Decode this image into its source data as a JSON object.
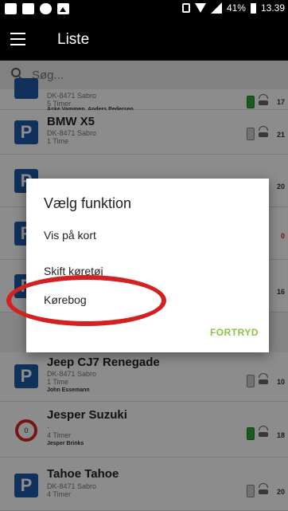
{
  "statusbar": {
    "battery_text": "41%",
    "time": "13.39"
  },
  "appbar": {
    "title": "Liste"
  },
  "search": {
    "placeholder": "Søg..."
  },
  "list": [
    {
      "name": "",
      "sub1": "DK-8471 Sabro",
      "sub2": "5 Timer",
      "owner": "Aske Vammen, Anders Pedersen",
      "number": "17",
      "battery": "green",
      "icon": "parking-icon"
    },
    {
      "name": "BMW X5",
      "sub1": "DK-8471 Sabro",
      "sub2": "1 Time",
      "owner": "",
      "number": "21",
      "battery": "gray",
      "icon": "parking-icon"
    },
    {
      "name": "",
      "sub1": "",
      "sub2": "",
      "owner": "",
      "number": "20",
      "battery": "",
      "icon": "parking-icon"
    },
    {
      "name": "",
      "sub1": "",
      "sub2": "",
      "owner": "",
      "number": "0",
      "battery": "",
      "icon": "parking-icon"
    },
    {
      "name": "",
      "sub1": "",
      "sub2": "",
      "owner": "",
      "number": "16",
      "battery": "",
      "icon": "parking-icon"
    },
    {
      "name": "Jeep CJ7 Renegade",
      "sub1": "DK-8471 Sabro",
      "sub2": "1 Time",
      "owner": "John Essemann",
      "number": "10",
      "battery": "gray",
      "icon": "parking-icon"
    },
    {
      "name": "Jesper Suzuki",
      "sub1": "-",
      "sub2": "4 Timer",
      "owner": "Jesper Brinks",
      "number": "18",
      "battery": "green",
      "icon": "speed-sign-icon",
      "sign_value": "0"
    },
    {
      "name": "Tahoe Tahoe",
      "sub1": "DK-8471 Sabro",
      "sub2": "4 Timer",
      "owner": "",
      "number": "20",
      "battery": "gray",
      "icon": "parking-icon"
    }
  ],
  "dialog": {
    "title": "Vælg funktion",
    "options": [
      "Vis på kort",
      "Skift køretøj",
      "Kørebog"
    ],
    "cancel": "FORTRYD"
  },
  "colors": {
    "accent": "#8bc34a",
    "highlight": "#d32121",
    "parking_blue": "#1d5aa8"
  }
}
